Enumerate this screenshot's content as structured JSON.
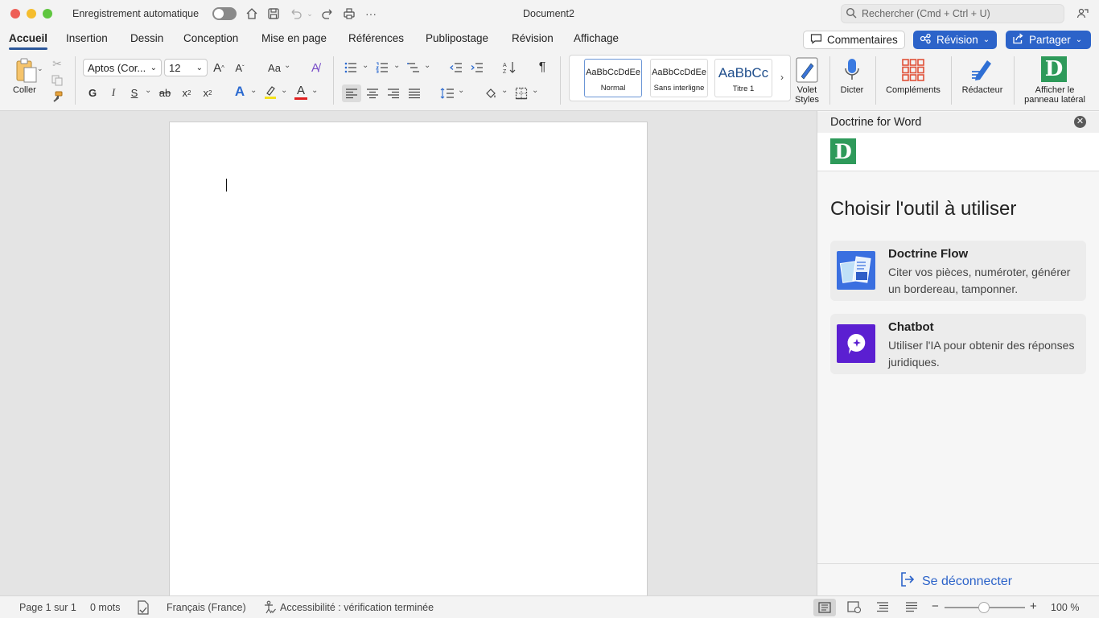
{
  "titlebar": {
    "autosave_label": "Enregistrement automatique",
    "document_title": "Document2",
    "search_placeholder": "Rechercher (Cmd + Ctrl + U)"
  },
  "tabs": [
    {
      "label": "Accueil"
    },
    {
      "label": "Insertion"
    },
    {
      "label": "Dessin"
    },
    {
      "label": "Conception"
    },
    {
      "label": "Mise en page"
    },
    {
      "label": "Références"
    },
    {
      "label": "Publipostage"
    },
    {
      "label": "Révision"
    },
    {
      "label": "Affichage"
    }
  ],
  "tab_actions": {
    "comments": "Commentaires",
    "review": "Révision",
    "share": "Partager"
  },
  "ribbon": {
    "paste_label": "Coller",
    "font_name": "Aptos (Cor...",
    "font_size": "12",
    "grow_font": "A",
    "shrink_font": "A",
    "change_case": "Aa",
    "bold": "G",
    "italic": "I",
    "underline": "S",
    "strike": "ab",
    "subscript": "x",
    "superscript": "x",
    "text_effects": "A",
    "font_color": "A",
    "pilcrow": "¶",
    "styles": [
      {
        "sample": "AaBbCcDdEe",
        "name": "Normal"
      },
      {
        "sample": "AaBbCcDdEe",
        "name": "Sans interligne"
      },
      {
        "sample": "AaBbCc",
        "name": "Titre 1"
      }
    ],
    "styles_pane": "Volet\nStyles",
    "dictate": "Dicter",
    "addins": "Compléments",
    "editor": "Rédacteur",
    "sidepanel": "Afficher le\npanneau latéral"
  },
  "panel": {
    "title": "Doctrine for Word",
    "logo_letter": "D",
    "heading": "Choisir l'outil à utiliser",
    "tools": [
      {
        "title": "Doctrine Flow",
        "desc": "Citer vos pièces, numéroter, générer un bordereau, tamponner."
      },
      {
        "title": "Chatbot",
        "desc": "Utiliser l'IA pour obtenir des réponses juridiques."
      }
    ],
    "logout": "Se déconnecter"
  },
  "statusbar": {
    "page": "Page 1 sur 1",
    "words": "0 mots",
    "language": "Français (France)",
    "accessibility": "Accessibilité : vérification terminée",
    "zoom": "100 %",
    "zoom_minus": "−",
    "zoom_plus": "+"
  },
  "colors": {
    "accent": "#2c63c9",
    "doctrine_green": "#2e9a5a",
    "flow_blue": "#3a6fe0",
    "chatbot_purple": "#5b1fd1"
  }
}
